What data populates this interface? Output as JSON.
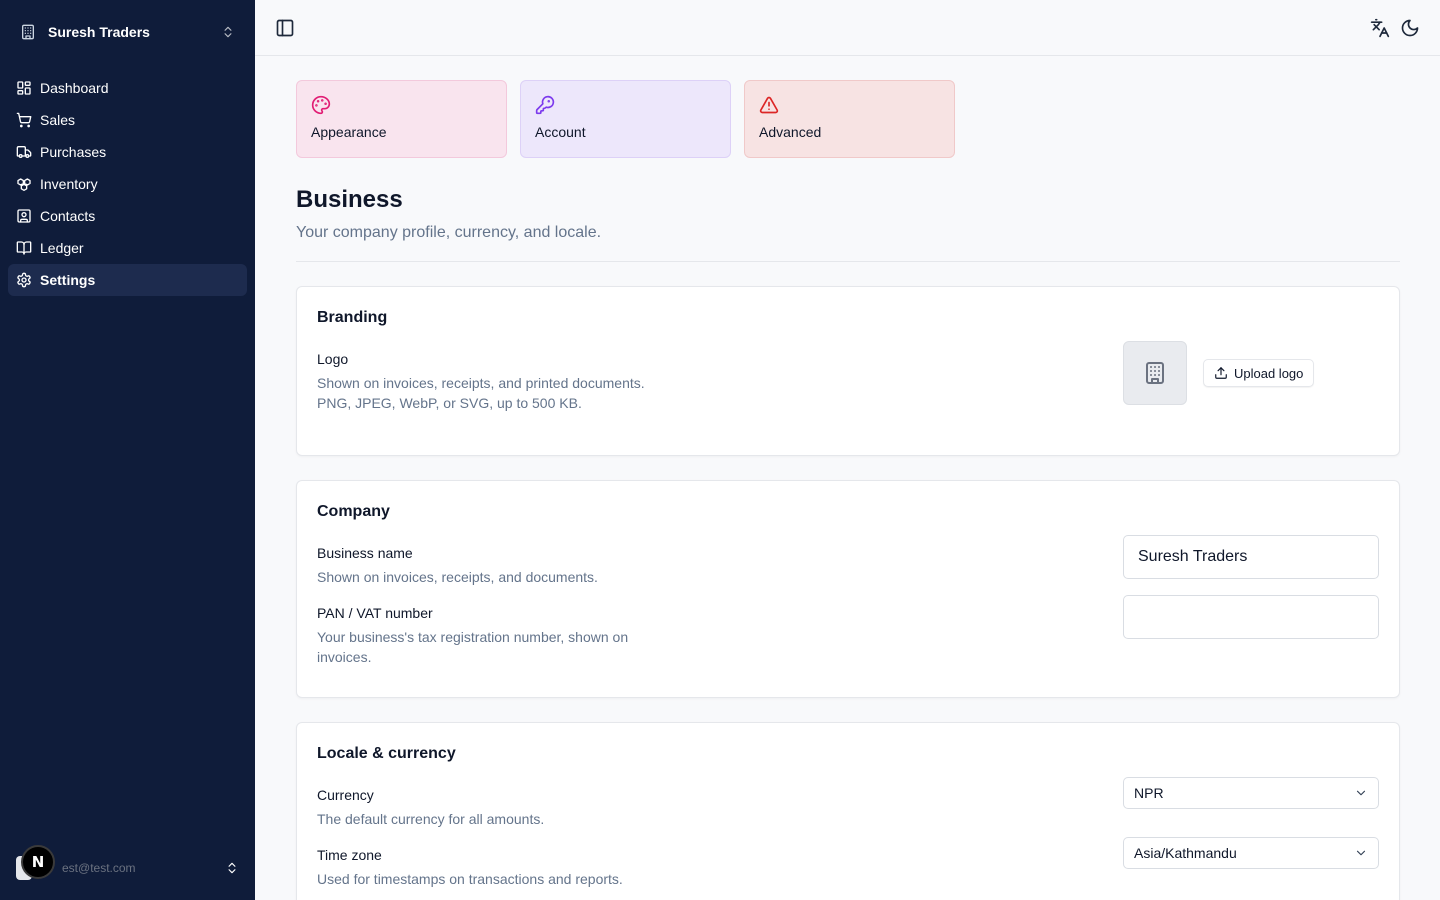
{
  "sidebar": {
    "org_name": "Suresh Traders",
    "items": [
      {
        "label": "Dashboard",
        "icon": "dashboard-icon"
      },
      {
        "label": "Sales",
        "icon": "cart-icon"
      },
      {
        "label": "Purchases",
        "icon": "truck-icon"
      },
      {
        "label": "Inventory",
        "icon": "boxes-icon"
      },
      {
        "label": "Contacts",
        "icon": "contact-icon"
      },
      {
        "label": "Ledger",
        "icon": "book-icon"
      },
      {
        "label": "Settings",
        "icon": "gear-icon",
        "active": true
      }
    ],
    "user_email": "est@test.com",
    "badge": "N"
  },
  "settings_tabs": [
    {
      "label": "Appearance",
      "icon": "palette-icon",
      "color": "#e11d74"
    },
    {
      "label": "Account",
      "icon": "key-icon",
      "color": "#7c3aed"
    },
    {
      "label": "Advanced",
      "icon": "warning-icon",
      "color": "#dc2626"
    }
  ],
  "page": {
    "title": "Business",
    "subtitle": "Your company profile, currency, and locale."
  },
  "branding": {
    "heading": "Branding",
    "logo_label": "Logo",
    "logo_desc": "Shown on invoices, receipts, and printed documents. PNG, JPEG, WebP, or SVG, up to 500 KB.",
    "upload_label": "Upload logo"
  },
  "company": {
    "heading": "Company",
    "name_label": "Business name",
    "name_desc": "Shown on invoices, receipts, and documents.",
    "name_value": "Suresh Traders",
    "pan_label": "PAN / VAT number",
    "pan_desc": "Your business's tax registration number, shown on invoices.",
    "pan_value": ""
  },
  "locale": {
    "heading": "Locale & currency",
    "currency_label": "Currency",
    "currency_desc": "The default currency for all amounts.",
    "currency_value": "NPR",
    "tz_label": "Time zone",
    "tz_desc": "Used for timestamps on transactions and reports.",
    "tz_value": "Asia/Kathmandu"
  }
}
